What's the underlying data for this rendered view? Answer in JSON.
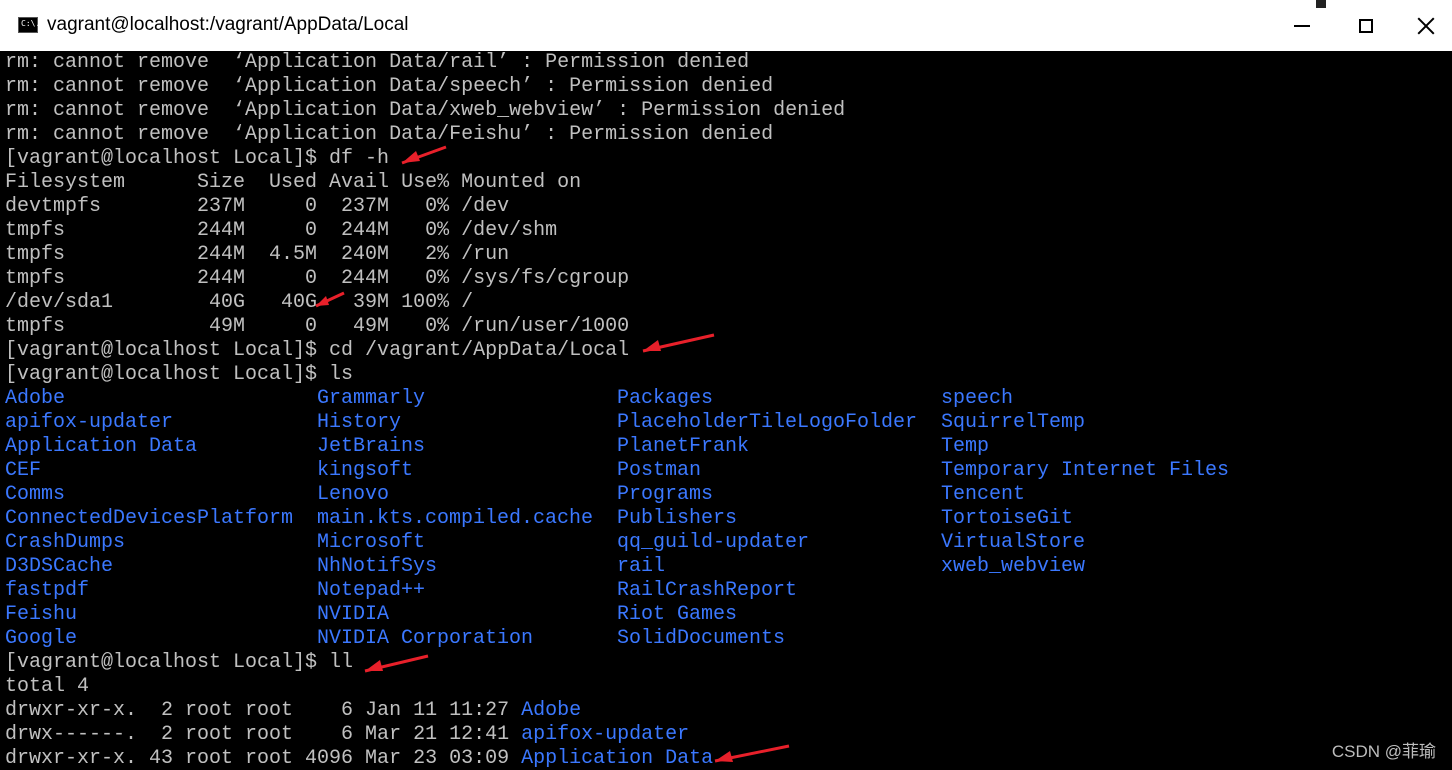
{
  "window": {
    "title": "vagrant@localhost:/vagrant/AppData/Local",
    "icon": "console-icon",
    "icon_text": "C:\\."
  },
  "terminal": {
    "lines_top": [
      "rm: cannot remove  ‘Application Data/rail’ : Permission denied",
      "rm: cannot remove  ‘Application Data/speech’ : Permission denied",
      "rm: cannot remove  ‘Application Data/xweb_webview’ : Permission denied",
      "rm: cannot remove  ‘Application Data/Feishu’ : Permission denied",
      "[vagrant@localhost Local]$ df -h",
      "Filesystem      Size  Used Avail Use% Mounted on",
      "devtmpfs        237M     0  237M   0% /dev",
      "tmpfs           244M     0  244M   0% /dev/shm",
      "tmpfs           244M  4.5M  240M   2% /run",
      "tmpfs           244M     0  244M   0% /sys/fs/cgroup",
      "/dev/sda1        40G   40G   39M 100% /",
      "tmpfs            49M     0   49M   0% /run/user/1000",
      "[vagrant@localhost Local]$ cd /vagrant/AppData/Local",
      "[vagrant@localhost Local]$ ls"
    ],
    "ls_columns": [
      [
        "Adobe",
        "apifox-updater",
        "Application Data",
        "CEF",
        "Comms",
        "ConnectedDevicesPlatform",
        "CrashDumps",
        "D3DSCache",
        "fastpdf",
        "Feishu",
        "Google"
      ],
      [
        "Grammarly",
        "History",
        "JetBrains",
        "kingsoft",
        "Lenovo",
        "main.kts.compiled.cache",
        "Microsoft",
        "NhNotifSys",
        "Notepad++",
        "NVIDIA",
        "NVIDIA Corporation"
      ],
      [
        "Packages",
        "PlaceholderTileLogoFolder",
        "PlanetFrank",
        "Postman",
        "Programs",
        "Publishers",
        "qq_guild-updater",
        "rail",
        "RailCrashReport",
        "Riot Games",
        "SolidDocuments"
      ],
      [
        "speech",
        "SquirrelTemp",
        "Temp",
        "Temporary Internet Files",
        "Tencent",
        "TortoiseGit",
        "VirtualStore",
        "xweb_webview"
      ]
    ],
    "ll_prompt": "[vagrant@localhost Local]$ ll",
    "ll_total": "total 4",
    "ll_rows": [
      {
        "meta": "drwxr-xr-x.  2 root root    6 Jan 11 11:27 ",
        "name": "Adobe"
      },
      {
        "meta": "drwx------.  2 root root    6 Mar 21 12:41 ",
        "name": "apifox-updater"
      },
      {
        "meta": "drwxr-xr-x. 43 root root 4096 Mar 23 03:09 ",
        "name": "Application Data"
      }
    ]
  },
  "colors": {
    "background": "#000000",
    "text": "#c0c0c0",
    "directory": "#3b78ff",
    "annotation_arrow": "#e8202a"
  },
  "watermark": "CSDN @菲瑜"
}
